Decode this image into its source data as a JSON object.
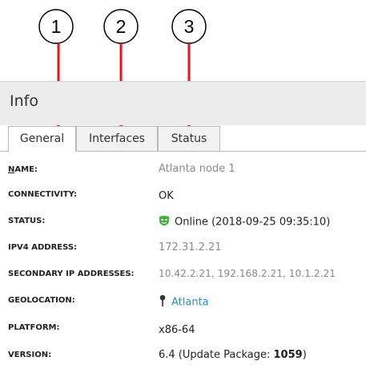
{
  "callouts": [
    {
      "number": "1"
    },
    {
      "number": "2"
    },
    {
      "number": "3"
    }
  ],
  "panel": {
    "title": "Info"
  },
  "tabs": [
    {
      "label": "General",
      "active": true
    },
    {
      "label": "Interfaces",
      "active": false
    },
    {
      "label": "Status",
      "active": false
    }
  ],
  "fields": {
    "name": {
      "label_first": "N",
      "label_rest": "AME:",
      "value": "Atlanta node 1"
    },
    "connectivity": {
      "label": "CONNECTIVITY:",
      "value": "OK"
    },
    "status": {
      "label": "STATUS:",
      "value": "Online (2018-09-25 09:35:10)",
      "icon": "online-mask-icon"
    },
    "ipv4": {
      "label": "IPV4 ADDRESS:",
      "value": "172.31.2.21"
    },
    "secondary_ip": {
      "label": "SECONDARY IP ADDRESSES:",
      "value": "10.42.2.21, 192.168.2.21, 10.1.2.21"
    },
    "geolocation": {
      "label": "GEOLOCATION:",
      "value": "Atlanta",
      "icon": "map-pin-icon"
    },
    "platform": {
      "label": "PLATFORM:",
      "value": "x86-64"
    },
    "version": {
      "label": "VERSION:",
      "value_prefix": "6.4 (Update Package: ",
      "value_bold": "1059",
      "value_suffix": ")"
    }
  },
  "colors": {
    "callout_arrow": "#e8141b",
    "link": "#1f8fd6",
    "online_icon": "#3cb43c",
    "header_bg": "#ececec"
  }
}
